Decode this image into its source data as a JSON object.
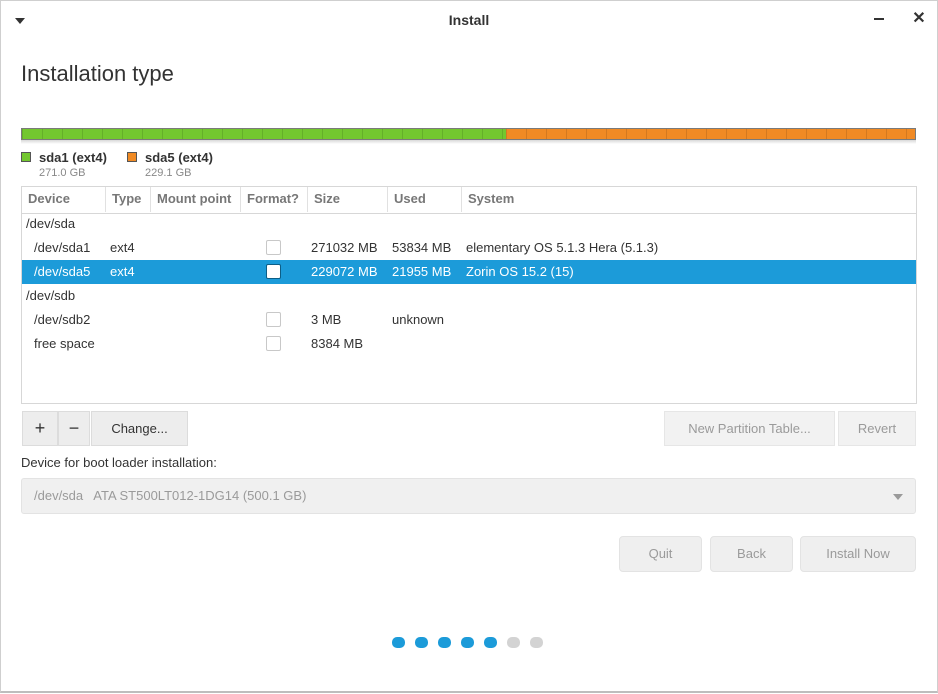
{
  "window": {
    "title": "Install"
  },
  "page": {
    "title": "Installation type"
  },
  "partition_bar": {
    "segments": [
      {
        "name": "sda1 (ext4)",
        "size": "271.0 GB",
        "color": "#73c72f",
        "fraction": 0.542
      },
      {
        "name": "sda5 (ext4)",
        "size": "229.1 GB",
        "color": "#f08a24",
        "fraction": 0.458
      }
    ]
  },
  "table": {
    "headers": [
      "Device",
      "Type",
      "Mount point",
      "Format?",
      "Size",
      "Used",
      "System"
    ],
    "rows": [
      {
        "device": "/dev/sda",
        "type": "",
        "mount": "",
        "format": null,
        "size": "",
        "used": "",
        "system": "",
        "group": true,
        "selected": false
      },
      {
        "device": "/dev/sda1",
        "type": "ext4",
        "mount": "",
        "format": false,
        "size": "271032 MB",
        "used": "53834 MB",
        "system": "elementary OS 5.1.3 Hera (5.1.3)",
        "group": false,
        "selected": false
      },
      {
        "device": "/dev/sda5",
        "type": "ext4",
        "mount": "",
        "format": false,
        "size": "229072 MB",
        "used": "21955 MB",
        "system": "Zorin OS 15.2 (15)",
        "group": false,
        "selected": true
      },
      {
        "device": "/dev/sdb",
        "type": "",
        "mount": "",
        "format": null,
        "size": "",
        "used": "",
        "system": "",
        "group": true,
        "selected": false
      },
      {
        "device": "/dev/sdb2",
        "type": "",
        "mount": "",
        "format": false,
        "size": "3 MB",
        "used": "unknown",
        "system": "",
        "group": false,
        "selected": false
      },
      {
        "device": "free space",
        "type": "",
        "mount": "",
        "format": false,
        "size": "8384 MB",
        "used": "",
        "system": "",
        "group": false,
        "selected": false
      }
    ]
  },
  "toolbar": {
    "add_label": "+",
    "remove_label": "−",
    "change_label": "Change...",
    "new_table_label": "New Partition Table...",
    "revert_label": "Revert"
  },
  "bootloader": {
    "label": "Device for boot loader installation:",
    "value": "/dev/sda   ATA ST500LT012-1DG14 (500.1 GB)"
  },
  "actions": {
    "quit": "Quit",
    "back": "Back",
    "install": "Install Now"
  },
  "progress": {
    "total_steps": 7,
    "current_step": 5,
    "active_color": "#1c9bd9",
    "inactive_color": "#d3d3d3"
  }
}
